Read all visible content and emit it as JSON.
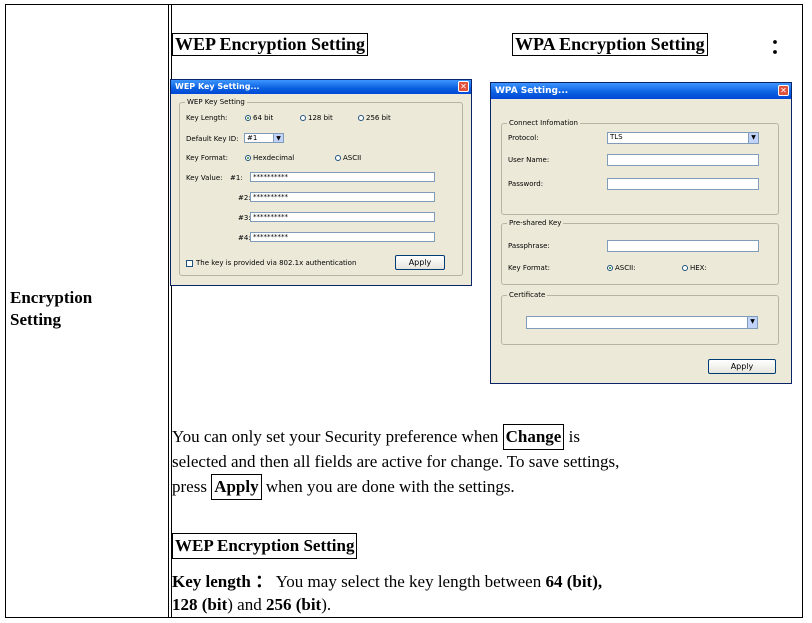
{
  "row_label": [
    "Encryption",
    "Setting"
  ],
  "header_wep": "WEP Encryption Setting",
  "header_wpa": "WPA Encryption Setting",
  "header_colon": "：",
  "wep_dialog": {
    "title": "WEP Key Setting...",
    "group": "WEP Key Setting",
    "key_length_label": "Key Length:",
    "options": [
      "64 bit",
      "128 bit",
      "256 bit"
    ],
    "default_key_label": "Default Key ID:",
    "default_key_value": "#1",
    "key_format_label": "Key Format:",
    "format_hex": "Hexdecimal",
    "format_ascii": "ASCII",
    "key_value_label": "Key Value:",
    "key_ids": [
      "#1:",
      "#2:",
      "#3:",
      "#4:"
    ],
    "masked": "**********",
    "checkbox_label": "The key is provided via 802.1x authentication",
    "apply": "Apply"
  },
  "wpa_dialog": {
    "title": "WPA Setting...",
    "connect_group": "Connect Infomation",
    "protocol_label": "Protocol:",
    "protocol_value": "TLS",
    "username_label": "User Name:",
    "password_label": "Password:",
    "psk_group": "Pre-shared Key",
    "passphrase_label": "Passphrase:",
    "key_format_label": "Key Format:",
    "ascii": "ASCII:",
    "hex": "HEX:",
    "cert_group": "Certificate",
    "apply": "Apply"
  },
  "para1": {
    "a": "You can only set your Security preference when ",
    "change": "Change",
    "b": " is",
    "line2": "selected and then all fields are active for change. To save settings,",
    "c": "press ",
    "apply": "Apply",
    "d": " when you are done with the settings."
  },
  "wep_header2": "WEP Encryption Setting",
  "keylen": {
    "label": "Key length",
    "colon": "：",
    "text": " You may select the key length between ",
    "v64": "64 (bit),",
    "v128": "128 (bit",
    "and": ") and ",
    "v256": "256 (bit",
    "end": ")."
  }
}
